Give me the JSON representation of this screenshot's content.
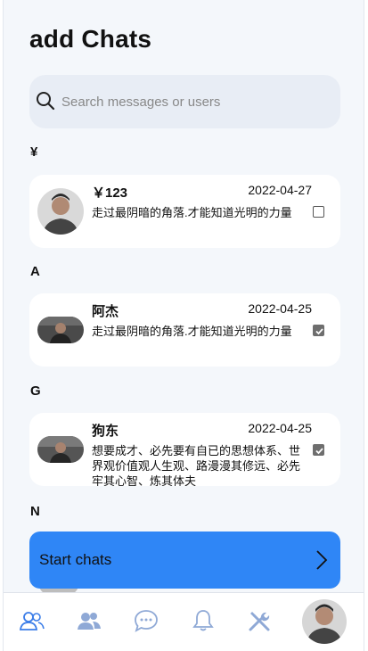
{
  "page": {
    "title": "add Chats"
  },
  "search": {
    "placeholder": "Search messages or users",
    "icon": "search-icon"
  },
  "sections": [
    {
      "letter": "¥"
    },
    {
      "letter": "A"
    },
    {
      "letter": "G"
    },
    {
      "letter": "N"
    }
  ],
  "contacts": [
    {
      "name": "￥123",
      "date": "2022-04-27",
      "message": "走过最阴暗的角落.才能知道光明的力量",
      "checked": false
    },
    {
      "name": "阿杰",
      "date": "2022-04-25",
      "message": "走过最阴暗的角落.才能知道光明的力量",
      "checked": true
    },
    {
      "name": "狗东",
      "date": "2022-04-25",
      "message": "想要成才、必先要有自已的思想体系、世界观价值观人生观、路漫漫其修远、必先牢其心智、炼其体夫",
      "checked": true
    }
  ],
  "start_button": {
    "label": "Start chats"
  },
  "tabbar": {
    "icons": [
      "contacts-icon",
      "group-icon",
      "chat-bubble-icon",
      "bell-icon",
      "tools-icon"
    ],
    "active_color": "#2f86f6",
    "icon_color": "#8fa9d6"
  },
  "colors": {
    "accent": "#2f86f6",
    "background": "#f4f7fb",
    "search_bg": "#e8edf5"
  }
}
